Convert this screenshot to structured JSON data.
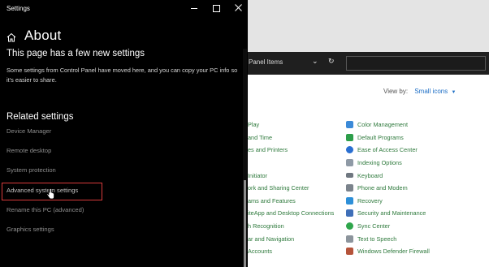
{
  "settings": {
    "window_title": "Settings",
    "page_title": "About",
    "section_heading": "This page has a few new settings",
    "section_body": "Some settings from Control Panel have moved here, and you can copy your PC info so it's easier to share.",
    "related_heading": "Related settings",
    "related_links": [
      "Device Manager",
      "Remote desktop",
      "System protection",
      "Advanced system settings",
      "Rename this PC (advanced)",
      "Graphics settings"
    ],
    "highlight_color": "#d83b3b"
  },
  "control_panel": {
    "address": "Panel Items",
    "view_by_label": "View by:",
    "view_by_value": "Small icons",
    "items_col1": [
      "Play",
      "and Time",
      "es and Printers",
      "",
      "Initiator",
      "ork and Sharing Center",
      "ams and Features",
      "iteApp and Desktop Connections",
      "h Recognition",
      "ar and Navigation",
      "Accounts"
    ],
    "items_col2": [
      "Color Management",
      "Default Programs",
      "Ease of Access Center",
      "Indexing Options",
      "Keyboard",
      "Phone and Modem",
      "Recovery",
      "Security and Maintenance",
      "Sync Center",
      "Text to Speech",
      "Windows Defender Firewall"
    ],
    "item_text_color": "#2f7a3d"
  }
}
